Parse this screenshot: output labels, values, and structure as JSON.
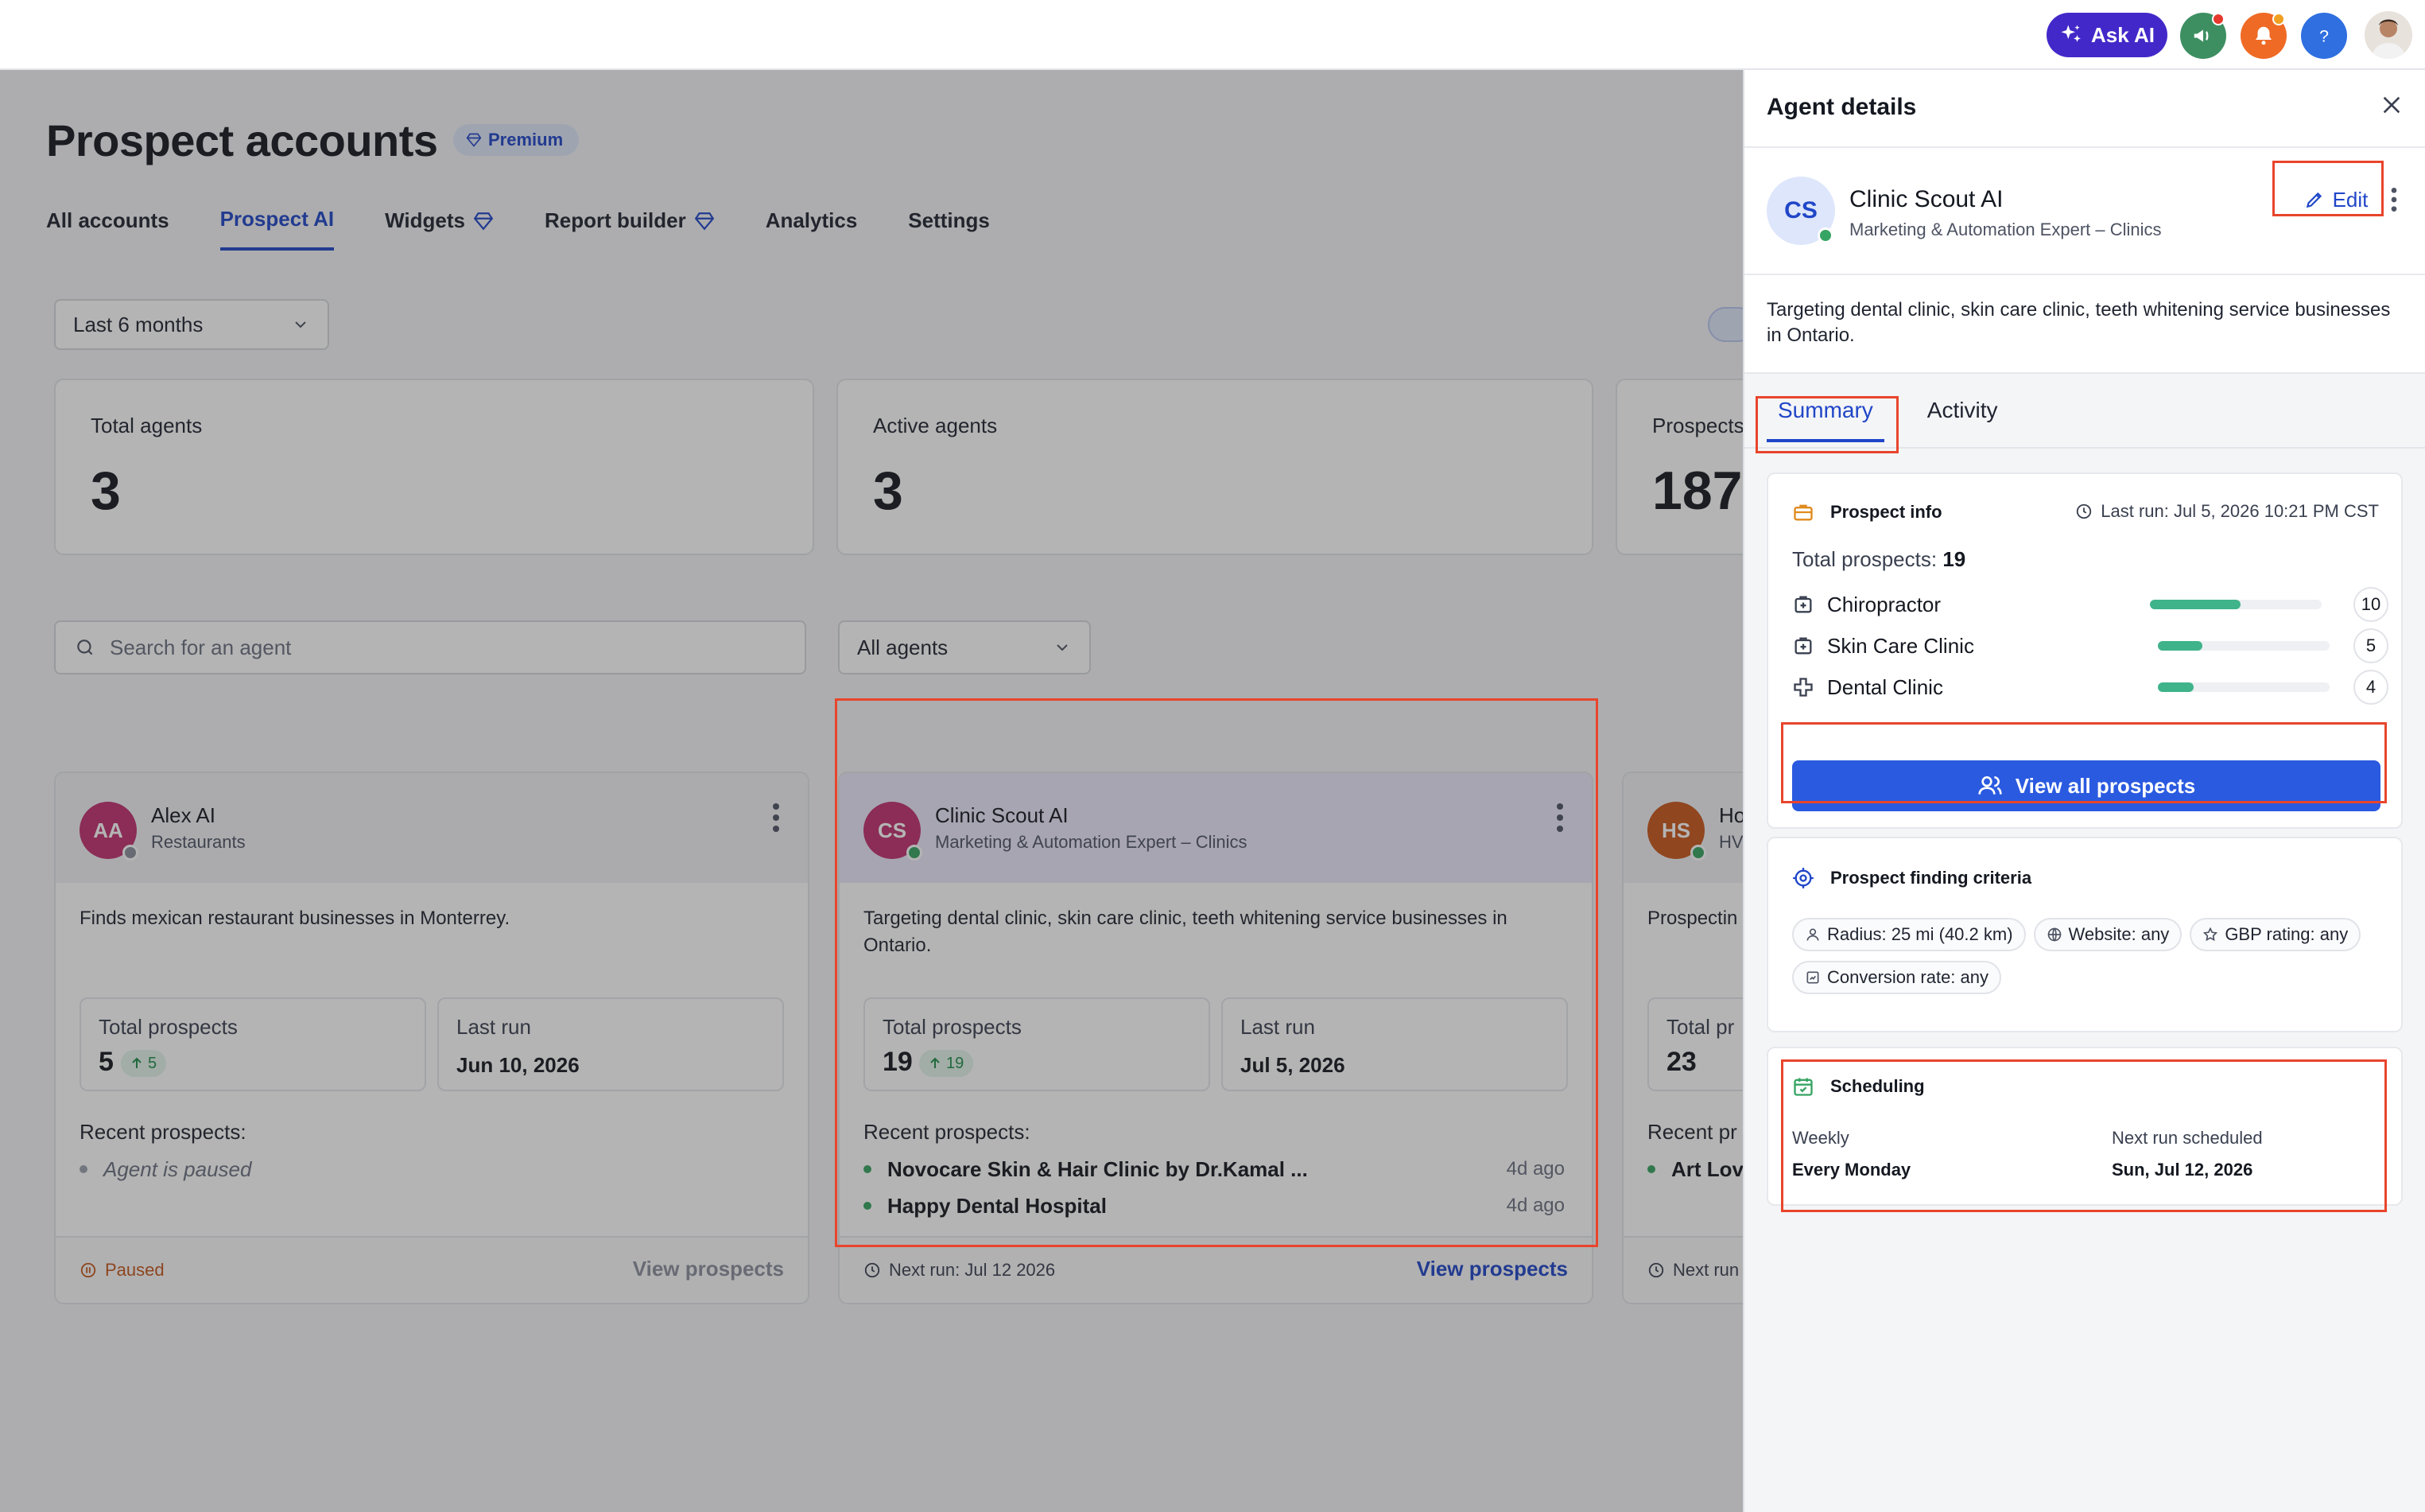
{
  "topbar": {
    "ask_ai_label": "Ask AI",
    "icons": [
      "sparkle-icon",
      "megaphone-icon",
      "bell-icon",
      "help-icon",
      "user-avatar"
    ],
    "colors": {
      "ask_ai": "#4328c9",
      "megaphone": "#3d8f62",
      "bell": "#ef6a25",
      "help": "#2f6fe0"
    }
  },
  "page": {
    "title": "Prospect accounts",
    "premium_label": "Premium",
    "tabs": [
      {
        "label": "All accounts"
      },
      {
        "label": "Prospect AI"
      },
      {
        "label": "Widgets"
      },
      {
        "label": "Report builder"
      },
      {
        "label": "Analytics"
      },
      {
        "label": "Settings"
      }
    ],
    "period_select": "Last 6 months",
    "stats": [
      {
        "label": "Total agents",
        "value": "3"
      },
      {
        "label": "Active agents",
        "value": "3"
      },
      {
        "label": "Prospects",
        "value": "187"
      }
    ],
    "search_placeholder": "Search for an agent",
    "agents_filter": "All agents"
  },
  "agents": [
    {
      "initials": "AA",
      "name": "Alex AI",
      "role": "Restaurants",
      "avatar_color": "#c0306f",
      "description": "Finds mexican restaurant businesses in Monterrey.",
      "total_prospects_label": "Total prospects",
      "total_prospects": "5",
      "delta": "5",
      "last_run_label": "Last run",
      "last_run": "Jun 10, 2026",
      "recent_label": "Recent prospects:",
      "paused_note": "Agent is paused",
      "status": "Paused",
      "view_label": "View prospects"
    },
    {
      "initials": "CS",
      "name": "Clinic Scout AI",
      "role": "Marketing & Automation Expert – Clinics",
      "avatar_color": "#c0306f",
      "description": "Targeting dental clinic, skin care clinic, teeth whitening service businesses in Ontario.",
      "total_prospects_label": "Total prospects",
      "total_prospects": "19",
      "delta": "19",
      "last_run_label": "Last run",
      "last_run": "Jul 5, 2026",
      "recent_label": "Recent prospects:",
      "recent": [
        {
          "name": "Novocare Skin & Hair Clinic by Dr.Kamal ...",
          "ago": "4d ago"
        },
        {
          "name": "Happy Dental Hospital",
          "ago": "4d ago"
        }
      ],
      "next_run": "Next run: Jul 12 2026",
      "view_label": "View prospects"
    },
    {
      "initials": "HS",
      "name": "Ho",
      "role": "HV",
      "avatar_color": "#c8561b",
      "description": "Prospectin",
      "total_prospects_label": "Total pr",
      "total_prospects": "23",
      "recent_label": "Recent pr",
      "recent": [
        {
          "name": "Art Love"
        }
      ],
      "next_run": "Next run"
    }
  ],
  "panel": {
    "title": "Agent details",
    "agent": {
      "initials": "CS",
      "name": "Clinic Scout AI",
      "role": "Marketing & Automation Expert – Clinics",
      "edit_label": "Edit",
      "description": "Targeting dental clinic, skin care clinic, teeth whitening service businesses in Ontario."
    },
    "tabs": [
      {
        "label": "Summary"
      },
      {
        "label": "Activity"
      }
    ],
    "prospect_info": {
      "title": "Prospect info",
      "last_run": "Last run: Jul 5, 2026 10:21 PM CST",
      "total_label": "Total prospects:",
      "total_value": "19",
      "categories": [
        {
          "name": "Chiropractor",
          "count": "10",
          "fraction": 0.53
        },
        {
          "name": "Skin Care Clinic",
          "count": "5",
          "fraction": 0.26
        },
        {
          "name": "Dental Clinic",
          "count": "4",
          "fraction": 0.21
        }
      ],
      "view_all_label": "View all prospects"
    },
    "criteria": {
      "title": "Prospect finding criteria",
      "chips": [
        "Radius: 25 mi (40.2 km)",
        "Website: any",
        "GBP rating: any",
        "Conversion rate: any"
      ]
    },
    "scheduling": {
      "title": "Scheduling",
      "frequency_label": "Weekly",
      "frequency_value": "Every Monday",
      "next_label": "Next run scheduled",
      "next_value": "Sun, Jul 12, 2026"
    }
  }
}
